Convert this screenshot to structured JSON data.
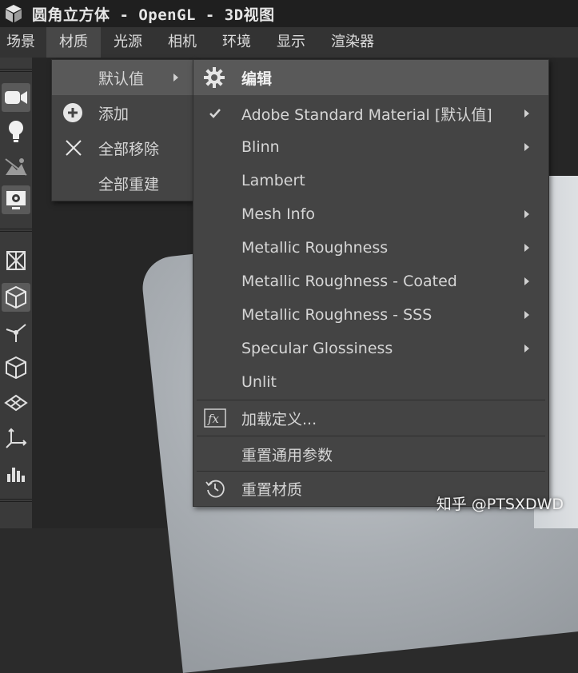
{
  "window": {
    "title": "圆角立方体 - OpenGL - 3D视图"
  },
  "menubar": {
    "items": [
      {
        "label": "场景"
      },
      {
        "label": "材质"
      },
      {
        "label": "光源"
      },
      {
        "label": "相机"
      },
      {
        "label": "环境"
      },
      {
        "label": "显示"
      },
      {
        "label": "渲染器"
      }
    ]
  },
  "material_menu": {
    "items": [
      {
        "label": "默认值"
      },
      {
        "label": "添加"
      },
      {
        "label": "全部移除"
      },
      {
        "label": "全部重建"
      }
    ]
  },
  "default_submenu": {
    "items": [
      {
        "label": "编辑"
      },
      {
        "label": "Adobe Standard Material [默认值]"
      },
      {
        "label": "Blinn"
      },
      {
        "label": "Lambert"
      },
      {
        "label": "Mesh Info"
      },
      {
        "label": "Metallic Roughness"
      },
      {
        "label": "Metallic Roughness - Coated"
      },
      {
        "label": "Metallic Roughness - SSS"
      },
      {
        "label": "Specular Glossiness"
      },
      {
        "label": "Unlit"
      },
      {
        "label": "加载定义..."
      },
      {
        "label": "重置通用参数"
      },
      {
        "label": "重置材质"
      }
    ]
  },
  "watermark": "知乎 @PTSXDWD",
  "colors": {
    "menu_bg": "#444444",
    "highlight": "#595959",
    "menubar_bg": "#333333",
    "titlebar_bg": "#1f1f1f"
  }
}
